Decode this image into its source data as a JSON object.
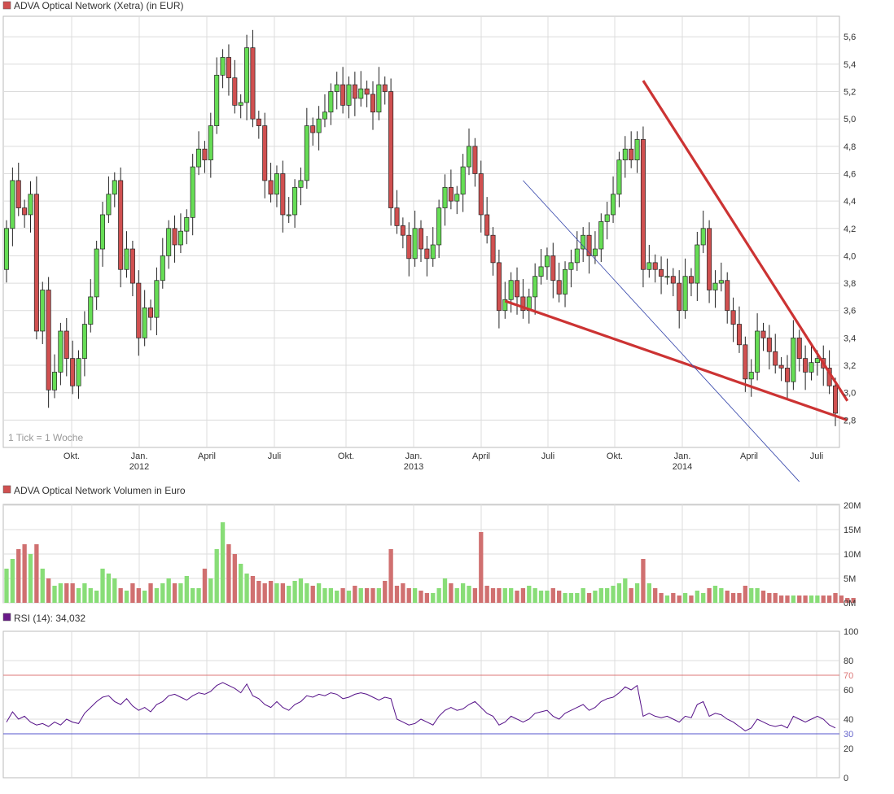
{
  "price": {
    "legend": "ADVA Optical Network (Xetra) (in EUR)",
    "tick_note": "1 Tick = 1 Woche",
    "yticks": [
      "2,8",
      "3,0",
      "3,2",
      "3,4",
      "3,6",
      "3,8",
      "4,0",
      "4,2",
      "4,4",
      "4,6",
      "4,8",
      "5,0",
      "5,2",
      "5,4",
      "5,6"
    ],
    "xticks": [
      "Okt.",
      "Jan.",
      "April",
      "Juli",
      "Okt.",
      "Jan.",
      "April",
      "Juli",
      "Okt.",
      "Jan.",
      "April",
      "Juli"
    ],
    "years": [
      "2012",
      "2013",
      "2014"
    ]
  },
  "volume": {
    "legend": "ADVA Optical Network Volumen in Euro",
    "yticks": [
      "0M",
      "5M",
      "10M",
      "15M",
      "20M"
    ]
  },
  "rsi": {
    "legend": "RSI (14): 34,032",
    "yticks": [
      "0",
      "20",
      "30",
      "40",
      "60",
      "70",
      "80",
      "100"
    ]
  },
  "colors": {
    "up": "#66dd55",
    "down": "#d05050",
    "trend": "#cc3333",
    "channel": "#3344aa",
    "rsi_line": "#551188",
    "grid": "#dcdcdc"
  },
  "chart_data": [
    {
      "type": "candlestick",
      "title": "ADVA Optical Network (Xetra) (in EUR)",
      "interval": "weekly",
      "ylim": [
        2.6,
        5.75
      ],
      "close": [
        4.2,
        4.55,
        4.35,
        4.3,
        4.45,
        3.45,
        3.75,
        3.02,
        3.15,
        3.45,
        3.25,
        3.05,
        3.25,
        3.5,
        3.7,
        4.05,
        4.3,
        4.45,
        4.55,
        3.9,
        4.05,
        3.8,
        3.4,
        3.62,
        3.55,
        3.82,
        4.0,
        4.2,
        4.08,
        4.18,
        4.28,
        4.65,
        4.78,
        4.7,
        4.95,
        5.32,
        5.45,
        5.3,
        5.1,
        5.12,
        5.52,
        5.0,
        4.95,
        4.55,
        4.45,
        4.6,
        4.3,
        4.3,
        4.5,
        4.55,
        4.95,
        4.9,
        5.0,
        5.05,
        5.2,
        5.25,
        5.1,
        5.25,
        5.15,
        5.22,
        5.18,
        5.05,
        5.25,
        5.2,
        4.35,
        4.22,
        4.15,
        3.98,
        4.2,
        4.05,
        3.98,
        4.08,
        4.35,
        4.5,
        4.4,
        4.45,
        4.65,
        4.8,
        4.6,
        4.3,
        4.15,
        3.95,
        3.6,
        3.68,
        3.82,
        3.7,
        3.6,
        3.7,
        3.85,
        3.92,
        4.0,
        3.82,
        3.72,
        3.9,
        3.95,
        4.05,
        4.15,
        4.0,
        4.05,
        4.25,
        4.3,
        4.45,
        4.7,
        4.78,
        4.7,
        4.85,
        3.9,
        3.95,
        3.9,
        3.85,
        3.85,
        3.8,
        3.6,
        3.85,
        3.8,
        4.08,
        4.2,
        3.75,
        3.8,
        3.82,
        3.6,
        3.5,
        3.35,
        3.1,
        3.15,
        3.45,
        3.4,
        3.3,
        3.2,
        3.18,
        3.08,
        3.4,
        3.25,
        3.15,
        3.22,
        3.25,
        3.18,
        3.05,
        2.85
      ],
      "open": [
        3.9,
        4.2,
        4.55,
        4.35,
        4.3,
        4.45,
        3.45,
        3.75,
        3.02,
        3.15,
        3.45,
        3.25,
        3.05,
        3.25,
        3.5,
        3.7,
        4.05,
        4.3,
        4.45,
        4.55,
        3.9,
        4.05,
        3.8,
        3.4,
        3.62,
        3.55,
        3.82,
        4.0,
        4.2,
        4.08,
        4.18,
        4.28,
        4.65,
        4.78,
        4.7,
        4.95,
        5.32,
        5.45,
        5.3,
        5.1,
        5.12,
        5.52,
        5.0,
        4.95,
        4.55,
        4.45,
        4.6,
        4.3,
        4.3,
        4.5,
        4.55,
        4.95,
        4.9,
        5.0,
        5.05,
        5.2,
        5.25,
        5.1,
        5.25,
        5.15,
        5.22,
        5.18,
        5.05,
        5.25,
        5.2,
        4.35,
        4.22,
        4.15,
        3.98,
        4.2,
        4.05,
        3.98,
        4.08,
        4.35,
        4.5,
        4.4,
        4.45,
        4.65,
        4.8,
        4.6,
        4.3,
        4.15,
        3.95,
        3.6,
        3.68,
        3.82,
        3.7,
        3.6,
        3.7,
        3.85,
        3.92,
        4.0,
        3.82,
        3.72,
        3.9,
        3.95,
        4.05,
        4.15,
        4.0,
        4.05,
        4.25,
        4.3,
        4.45,
        4.7,
        4.78,
        4.7,
        4.85,
        3.9,
        3.95,
        3.9,
        3.85,
        3.85,
        3.8,
        3.6,
        3.85,
        3.8,
        4.08,
        4.2,
        3.75,
        3.8,
        3.82,
        3.6,
        3.5,
        3.35,
        3.1,
        3.15,
        3.45,
        3.4,
        3.3,
        3.2,
        3.18,
        3.08,
        3.4,
        3.25,
        3.15,
        3.22,
        3.25,
        3.18,
        3.05
      ],
      "trendlines": [
        {
          "from": [
            106,
            5.28
          ],
          "to": [
            140,
            2.94
          ]
        },
        {
          "from": [
            83,
            3.67
          ],
          "to": [
            140,
            2.8
          ]
        },
        {
          "from": [
            86,
            4.55
          ],
          "to": [
            132,
            2.35
          ]
        }
      ]
    },
    {
      "type": "bar",
      "title": "ADVA Optical Network Volumen in Euro",
      "ylim": [
        0,
        20
      ],
      "unit": "M",
      "values": [
        7,
        9,
        11,
        12,
        10,
        12,
        7,
        5,
        3.5,
        4,
        4,
        4,
        3,
        4,
        3,
        2.5,
        7,
        6,
        5,
        3,
        2.5,
        4,
        3,
        2.5,
        4,
        3,
        4,
        5,
        4,
        4,
        5.5,
        3,
        3,
        7,
        5,
        11,
        16.5,
        12,
        10,
        8,
        6,
        5.5,
        4.5,
        4,
        4.5,
        4,
        4,
        3.5,
        4.5,
        5,
        4,
        3.5,
        4,
        3,
        3,
        2.5,
        3,
        2.5,
        3.5,
        3,
        3,
        3,
        3,
        4.5,
        11,
        3.5,
        4,
        3,
        3,
        2.5,
        2,
        2,
        3,
        5,
        4,
        3,
        4,
        3.5,
        3,
        14.5,
        3.5,
        3,
        3,
        3,
        3,
        2.5,
        3,
        3.5,
        3,
        2.5,
        2.5,
        3,
        2.5,
        2,
        2,
        2,
        3,
        2,
        2.5,
        3,
        3,
        3.5,
        4,
        5,
        3,
        4,
        9,
        4,
        3,
        2,
        1.5,
        2,
        1.5,
        2,
        1.5,
        2.5,
        2,
        3,
        3.5,
        3,
        2.5,
        2,
        2,
        3.5,
        3,
        3,
        2.5,
        2,
        2,
        1.5,
        1.5,
        1.5,
        1.5,
        1.5,
        1.5,
        1.5,
        1.5,
        1.5,
        2,
        1.5,
        1,
        1
      ]
    },
    {
      "type": "line",
      "title": "RSI (14): 34,032",
      "ylim": [
        0,
        100
      ],
      "reference_lines": [
        70,
        30
      ],
      "values": [
        38,
        45,
        40,
        42,
        38,
        36,
        37,
        35,
        38,
        36,
        40,
        38,
        37,
        44,
        48,
        52,
        55,
        56,
        52,
        50,
        54,
        49,
        46,
        48,
        45,
        50,
        52,
        56,
        57,
        55,
        53,
        56,
        58,
        57,
        59,
        63,
        65,
        63,
        61,
        58,
        64,
        56,
        54,
        50,
        48,
        52,
        48,
        46,
        50,
        52,
        56,
        55,
        57,
        56,
        58,
        57,
        54,
        55,
        57,
        58,
        57,
        55,
        53,
        55,
        54,
        40,
        38,
        36,
        37,
        40,
        38,
        36,
        42,
        46,
        48,
        46,
        47,
        50,
        52,
        48,
        44,
        42,
        36,
        38,
        42,
        40,
        38,
        40,
        44,
        45,
        46,
        42,
        40,
        44,
        46,
        48,
        50,
        46,
        48,
        52,
        54,
        55,
        58,
        62,
        60,
        63,
        42,
        44,
        42,
        41,
        42,
        40,
        38,
        42,
        41,
        50,
        52,
        42,
        44,
        43,
        40,
        38,
        35,
        32,
        34,
        40,
        38,
        36,
        35,
        36,
        34,
        42,
        40,
        38,
        40,
        42,
        40,
        36,
        34
      ]
    }
  ]
}
